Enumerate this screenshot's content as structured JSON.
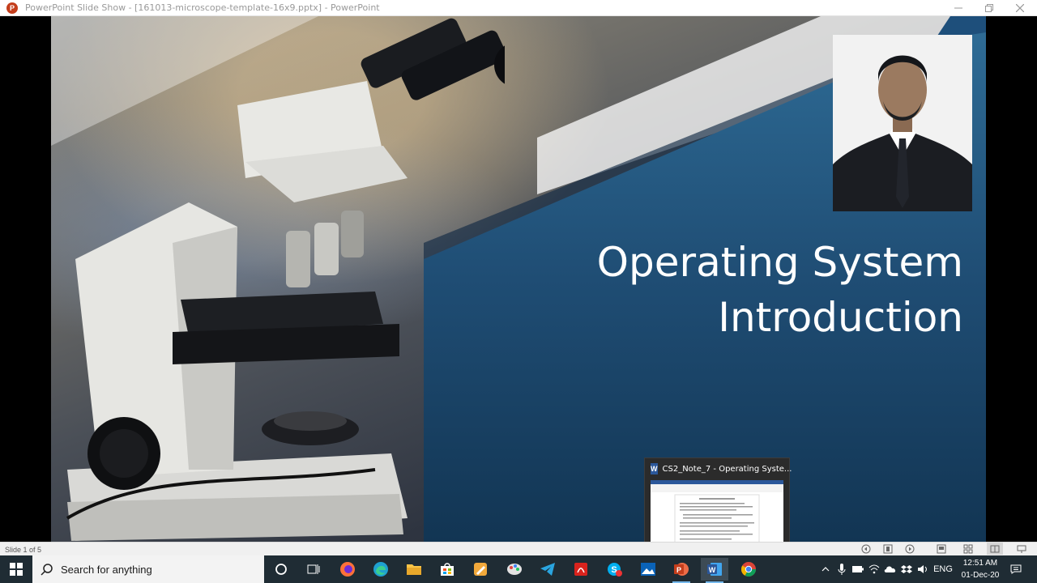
{
  "window": {
    "title": "PowerPoint Slide Show - [161013-microscope-template-16x9.pptx] - PowerPoint",
    "app_icon_letter": "P",
    "controls": [
      "minimize-icon",
      "restore-icon",
      "close-icon"
    ]
  },
  "slide": {
    "title_line1": "Operating System",
    "title_line2": "Introduction",
    "background": "microscope-photo",
    "accent_blue": "#1f4d74"
  },
  "thumbnail": {
    "icon_letter": "W",
    "label": "CS2_Note_7 - Operating Syste..."
  },
  "statusbar": {
    "slide_indicator": "Slide 1 of 5",
    "buttons": [
      "previous-icon",
      "slide-sorter-icon",
      "next-icon",
      "normal-view-icon",
      "grid-view-icon",
      "reading-view-icon",
      "slideshow-icon"
    ]
  },
  "taskbar": {
    "search_placeholder": "Search for anything",
    "apps": [
      "cortana-icon",
      "task-view-icon",
      "firefox-icon",
      "edge-icon",
      "file-explorer-icon",
      "store-icon",
      "sketchbook-icon",
      "paint-icon",
      "telegram-icon",
      "acrobat-icon",
      "skype-icon",
      "photos-icon",
      "powerpoint-icon",
      "word-icon",
      "chrome-icon"
    ],
    "language": "ENG",
    "time": "12:51 AM",
    "date": "01-Dec-20"
  }
}
